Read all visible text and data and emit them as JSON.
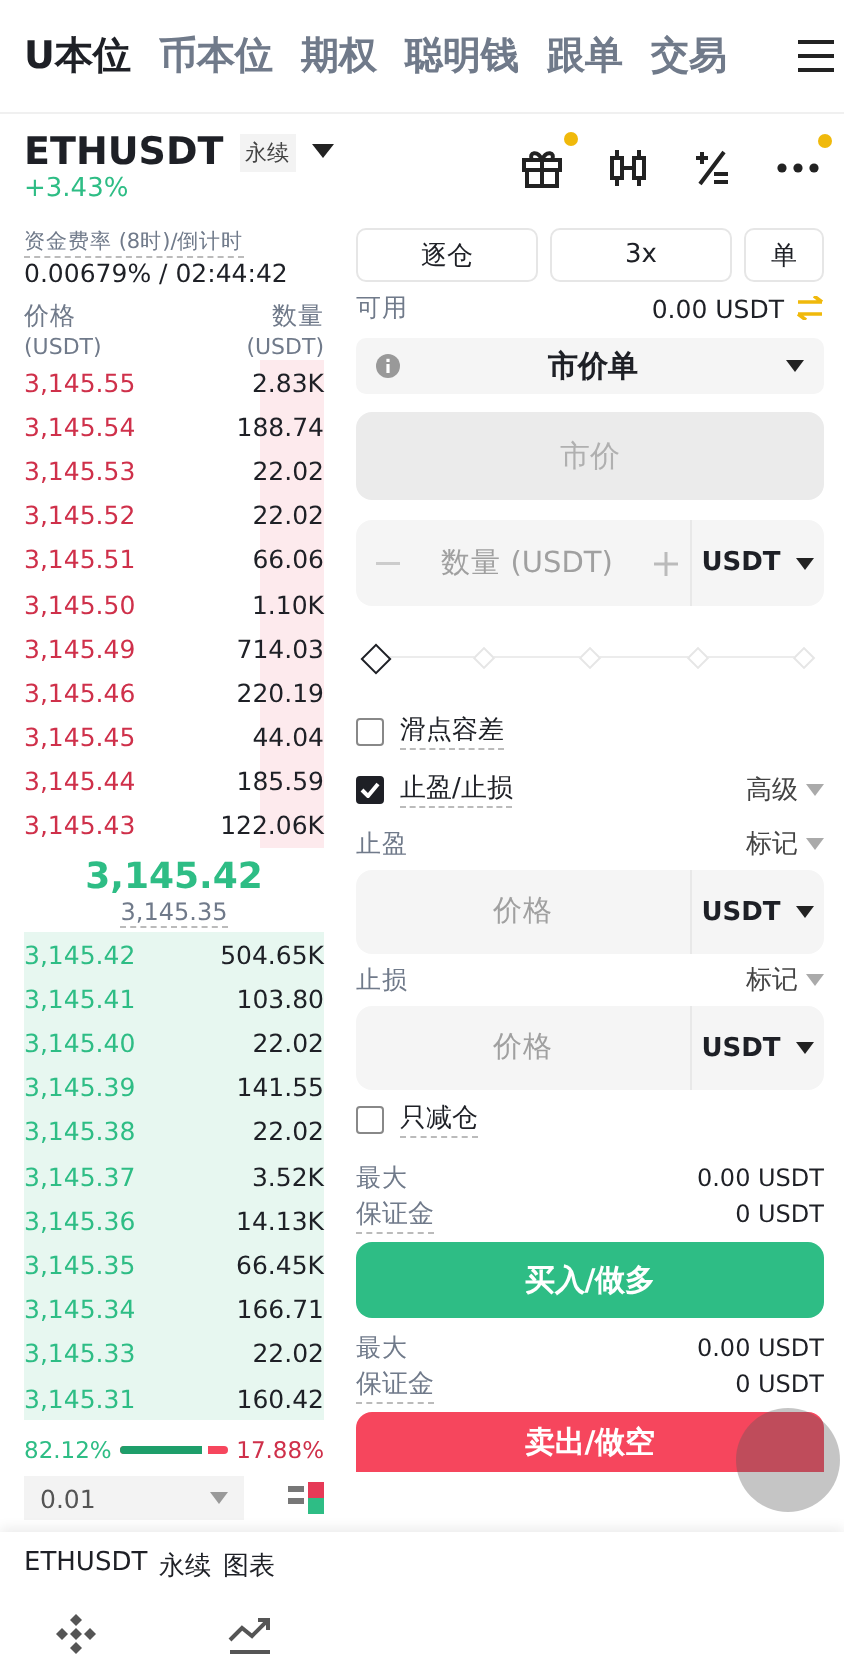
{
  "tabs": [
    {
      "label": "U本位",
      "selected": true
    },
    {
      "label": "币本位",
      "selected": false
    },
    {
      "label": "期权",
      "selected": false
    },
    {
      "label": "聪明钱",
      "selected": false
    },
    {
      "label": "跟单",
      "selected": false
    },
    {
      "label": "交易",
      "selected": false
    }
  ],
  "header": {
    "symbol": "ETHUSDT",
    "contract_tag": "永续",
    "change": "+3.43%",
    "gift_notification": true,
    "more_notification": true
  },
  "funding": {
    "label": "资金费率 (8时)/倒计时",
    "value": "0.00679% / 02:44:42"
  },
  "order_book": {
    "price_header": "价格",
    "qty_header": "数量",
    "price_unit": "(USDT)",
    "qty_unit": "(USDT)",
    "asks": [
      {
        "price": "3,145.55",
        "qty": "2.83K"
      },
      {
        "price": "3,145.54",
        "qty": "188.74"
      },
      {
        "price": "3,145.53",
        "qty": "22.02"
      },
      {
        "price": "3,145.52",
        "qty": "22.02"
      },
      {
        "price": "3,145.51",
        "qty": "66.06"
      },
      {
        "price": "3,145.50",
        "qty": "1.10K"
      },
      {
        "price": "3,145.49",
        "qty": "714.03"
      },
      {
        "price": "3,145.46",
        "qty": "220.19"
      },
      {
        "price": "3,145.45",
        "qty": "44.04"
      },
      {
        "price": "3,145.44",
        "qty": "185.59"
      },
      {
        "price": "3,145.43",
        "qty": "122.06K"
      }
    ],
    "last_price": "3,145.42",
    "mark_price": "3,145.35",
    "bids": [
      {
        "price": "3,145.42",
        "qty": "504.65K"
      },
      {
        "price": "3,145.41",
        "qty": "103.80"
      },
      {
        "price": "3,145.40",
        "qty": "22.02"
      },
      {
        "price": "3,145.39",
        "qty": "141.55"
      },
      {
        "price": "3,145.38",
        "qty": "22.02"
      },
      {
        "price": "3,145.37",
        "qty": "3.52K"
      },
      {
        "price": "3,145.36",
        "qty": "14.13K"
      },
      {
        "price": "3,145.35",
        "qty": "66.45K"
      },
      {
        "price": "3,145.34",
        "qty": "166.71"
      },
      {
        "price": "3,145.33",
        "qty": "22.02"
      },
      {
        "price": "3,145.31",
        "qty": "160.42"
      }
    ],
    "buy_ratio": "82.12%",
    "sell_ratio": "17.88%",
    "ratio": {
      "level": 0.82
    },
    "precision": "0.01"
  },
  "order_form": {
    "margin_mode": "逐仓",
    "leverage": "3x",
    "position_mode": "单",
    "available_label": "可用",
    "available": "0.00 USDT",
    "order_type": "市价单",
    "price_field": "市价",
    "qty_placeholder": "数量 (USDT)",
    "qty_unit": "USDT",
    "slider": {
      "level": 0
    },
    "options": [
      {
        "label": "滑点容差",
        "checked": false
      },
      {
        "label": "止盈/止损",
        "checked": true,
        "advanced": "高级"
      }
    ],
    "tp": {
      "label": "止盈",
      "trigger": "标记",
      "placeholder": "价格",
      "unit": "USDT"
    },
    "sl": {
      "label": "止损",
      "trigger": "标记",
      "placeholder": "价格",
      "unit": "USDT"
    },
    "reduce_only": {
      "label": "只减仓",
      "checked": false
    },
    "buy": {
      "max_label": "最大",
      "max": "0.00 USDT",
      "margin_label": "保证金",
      "margin": "0 USDT",
      "button": "买入/做多"
    },
    "sell": {
      "max_label": "最大",
      "max": "0.00 USDT",
      "margin_label": "保证金",
      "margin": "0 USDT",
      "button": "卖出/做空"
    }
  },
  "bottom_sheet": {
    "symbol": "ETHUSDT",
    "contract": "永续",
    "view": "图表"
  }
}
